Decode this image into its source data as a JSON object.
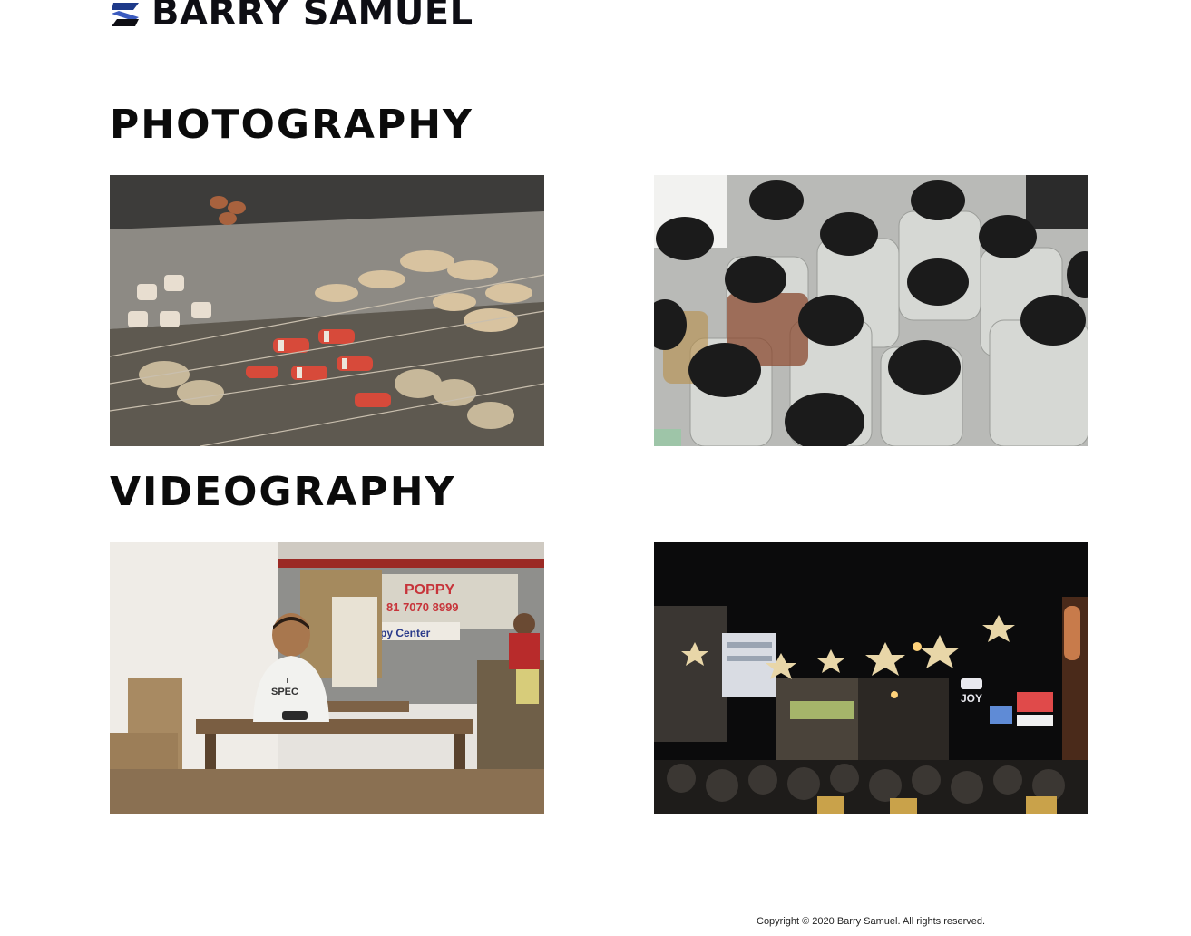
{
  "brand": {
    "name": "BARRY SAMUEL",
    "mark_colors": [
      "#1e3a8a",
      "#0e0e14"
    ]
  },
  "sections": {
    "photography": {
      "title": "PHOTOGRAPHY",
      "items": [
        {
          "subject": "skewered street food on metal trays"
        },
        {
          "subject": "rows of plastic bottles with black caps"
        }
      ]
    },
    "videography": {
      "title": "VIDEOGRAPHY",
      "items": [
        {
          "subject": "young man seated at a wooden table in a diner",
          "signs": {
            "shop": "POPPY",
            "phone": "81 7070 8999",
            "store": "py Center",
            "shirt": "SPEC"
          }
        },
        {
          "subject": "night street with star-shaped lights and crowd",
          "signs": {
            "brand": "JOY"
          }
        }
      ]
    }
  },
  "footer": {
    "copyright": "Copyright © 2020 Barry Samuel. All rights reserved."
  }
}
